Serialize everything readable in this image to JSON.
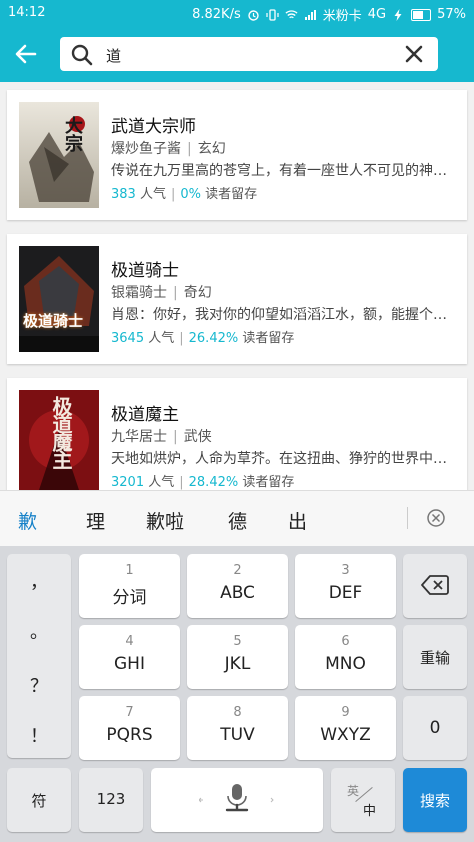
{
  "status_bar": {
    "time": "14:12",
    "speed": "8.82K/s",
    "carrier": "米粉卡",
    "network": "4G",
    "battery": "57%"
  },
  "search": {
    "query": "道",
    "back_icon": "arrow-left-icon",
    "search_icon": "magnifier-icon",
    "clear_icon": "close-icon"
  },
  "books": [
    {
      "title": "武道大宗师",
      "author": "爆炒鱼子酱",
      "genre": "玄幻",
      "desc": "传说在九万里高的苍穹上，有着一座世人不可见的神…",
      "popularity": "383",
      "popularity_label": "人气",
      "retention": "0%",
      "retention_label": "读者留存",
      "cover_text": "大宗"
    },
    {
      "title": "极道骑士",
      "author": "银霜骑士",
      "genre": "奇幻",
      "desc": "肖恩：你好，我对你的仰望如滔滔江水，额，能握个手…",
      "popularity": "3645",
      "popularity_label": "人气",
      "retention": "26.42%",
      "retention_label": "读者留存",
      "cover_text": "极道骑士"
    },
    {
      "title": "极道魔主",
      "author": "九华居士",
      "genre": "武侠",
      "desc": "天地如烘炉，人命为草芥。在这扭曲、狰狞的世界中，…",
      "popularity": "3201",
      "popularity_label": "人气",
      "retention": "28.42%",
      "retention_label": "读者留存",
      "cover_text": "极道魔主"
    }
  ],
  "candidates": [
    "歉",
    "理",
    "歉啦",
    "德",
    "出"
  ],
  "keyboard": {
    "punctuation": [
      "，",
      "。",
      "？",
      "！"
    ],
    "keys": [
      {
        "num": "1",
        "label": "分词"
      },
      {
        "num": "2",
        "label": "ABC"
      },
      {
        "num": "3",
        "label": "DEF"
      },
      {
        "num": "4",
        "label": "GHI"
      },
      {
        "num": "5",
        "label": "JKL"
      },
      {
        "num": "6",
        "label": "MNO"
      },
      {
        "num": "7",
        "label": "PQRS"
      },
      {
        "num": "8",
        "label": "TUV"
      },
      {
        "num": "9",
        "label": "WXYZ"
      }
    ],
    "reinput": "重输",
    "zero": "0",
    "symbols": "符",
    "numbers": "123",
    "lang_en": "英",
    "lang_zh": "中",
    "search": "搜索"
  },
  "colors": {
    "accent": "#16b8cf",
    "key_blue": "#1e8ad7"
  }
}
